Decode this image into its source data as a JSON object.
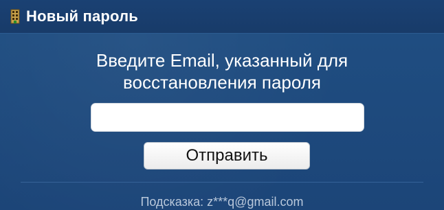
{
  "header": {
    "icon": "building-icon",
    "title": "Новый пароль"
  },
  "form": {
    "prompt_line1": "Введите Email, указанный для",
    "prompt_line2": "восстановления пароля",
    "email_value": "",
    "email_placeholder": "",
    "submit_label": "Отправить"
  },
  "hint": {
    "label": "Подсказка:",
    "value": "z***q@gmail.com"
  },
  "colors": {
    "background": "#1d4a7c",
    "header": "#183b69",
    "text": "#ffffff",
    "hint_text": "#b9c8db"
  }
}
